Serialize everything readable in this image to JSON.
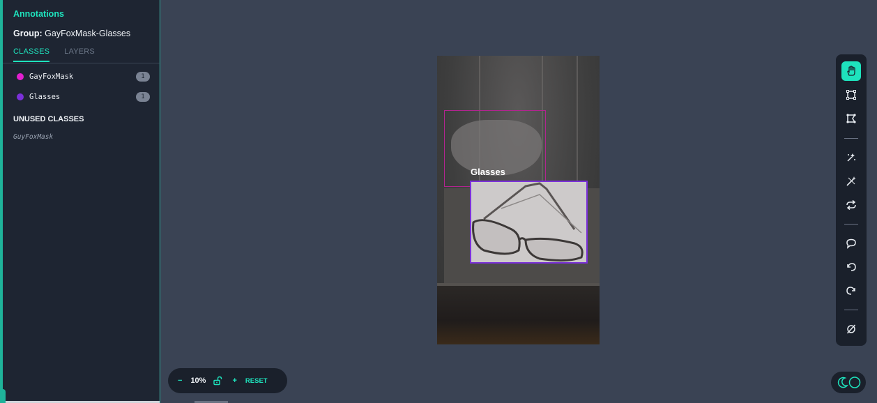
{
  "sidebar": {
    "title": "Annotations",
    "group_label": "Group:",
    "group_name": "GayFoxMask-Glasses",
    "tabs": [
      {
        "label": "CLASSES",
        "active": true
      },
      {
        "label": "LAYERS",
        "active": false
      }
    ],
    "classes": [
      {
        "name": "GayFoxMask",
        "color": "#e21fd0",
        "count": "1"
      },
      {
        "name": "Glasses",
        "color": "#7b30d9",
        "count": "1"
      }
    ],
    "unused_heading": "UNUSED CLASSES",
    "unused": [
      "GuyFoxMask"
    ]
  },
  "canvas": {
    "label": "Glasses",
    "mask_box_color": "#b2248f",
    "glasses_box_color": "#7b30d9"
  },
  "toolbar": {
    "accent": "#1ee3bd",
    "tools": [
      "hand-icon",
      "rectangle-icon",
      "polygon-icon",
      "smart-select-icon",
      "magic-wand-icon",
      "repeat-icon",
      "comment-icon",
      "undo-icon",
      "redo-icon",
      "hide-icon"
    ]
  },
  "zoom": {
    "minus": "−",
    "value": "10%",
    "plus": "+",
    "reset": "RESET"
  }
}
